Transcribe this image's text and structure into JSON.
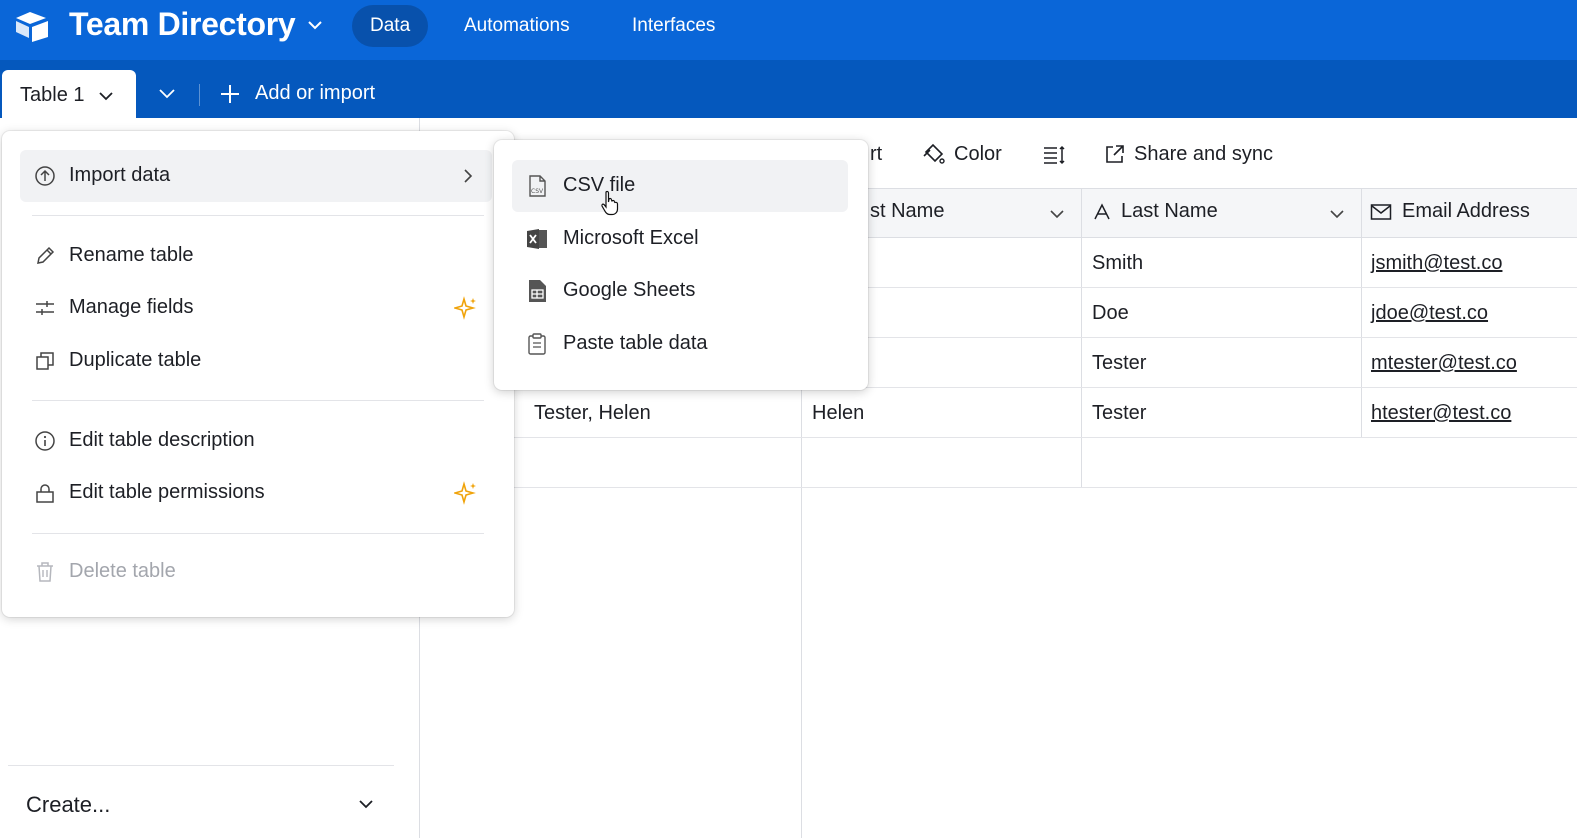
{
  "header": {
    "base_title": "Team Directory",
    "nav": {
      "data": "Data",
      "automations": "Automations",
      "interfaces": "Interfaces"
    }
  },
  "tablebar": {
    "active_table": "Table 1",
    "add_or_import": "Add or import"
  },
  "toolbar": {
    "sort_fragment": "rt",
    "color": "Color",
    "share_and_sync": "Share and sync"
  },
  "grid": {
    "columns": {
      "first_name_fragment": "st Name",
      "last_name": "Last Name",
      "email": "Email Address"
    },
    "rows": [
      {
        "name": "",
        "first": "",
        "last": "Smith",
        "email": "jsmith@test.co"
      },
      {
        "name": "",
        "first": "",
        "last": "Doe",
        "email": "jdoe@test.co"
      },
      {
        "name": "",
        "first": "",
        "last": "Tester",
        "email": "mtester@test.co"
      },
      {
        "name": "Tester, Helen",
        "first": "Helen",
        "last": "Tester",
        "email": "htester@test.co"
      }
    ]
  },
  "context_menu": {
    "import_data": "Import data",
    "rename_table": "Rename table",
    "manage_fields": "Manage fields",
    "duplicate_table": "Duplicate table",
    "edit_description": "Edit table description",
    "edit_permissions": "Edit table permissions",
    "delete_table": "Delete table"
  },
  "import_submenu": {
    "csv": "CSV file",
    "excel": "Microsoft Excel",
    "sheets": "Google Sheets",
    "paste": "Paste table data"
  },
  "sidebar": {
    "create": "Create..."
  },
  "colors": {
    "header_blue": "#0a66d8",
    "tablebar_blue": "#0558bd",
    "sparkle": "#f0a30a"
  }
}
